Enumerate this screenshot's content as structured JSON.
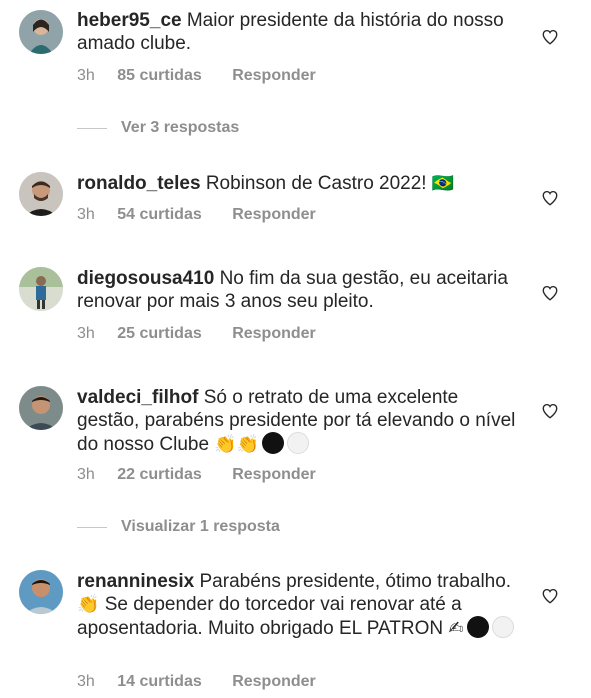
{
  "comments": [
    {
      "username": "heber95_ce",
      "text": "Maior presidente da história do nosso amado clube.",
      "time": "3h",
      "likes": "85 curtidas",
      "reply": "Responder",
      "view_replies": "Ver 3 respostas"
    },
    {
      "username": "ronaldo_teles",
      "text": "Robinson de Castro 2022!",
      "emoji": "🇧🇷",
      "time": "3h",
      "likes": "54 curtidas",
      "reply": "Responder"
    },
    {
      "username": "diegosousa410",
      "text": "No fim da sua gestão, eu aceitaria renovar por mais 3 anos seu pleito.",
      "time": "3h",
      "likes": "25 curtidas",
      "reply": "Responder"
    },
    {
      "username": "valdeci_filhof",
      "text": "Só o retrato de uma excelente gestão, parabéns presidente por tá elevando o nível do nosso Clube",
      "emoji": "👏👏",
      "time": "3h",
      "likes": "22 curtidas",
      "reply": "Responder",
      "view_replies": "Visualizar 1 resposta"
    },
    {
      "username": "renanninesix",
      "text_part1": "Parabéns presidente, ótimo trabalho.",
      "emoji1": "👏",
      "text_part2": "Se depender do torcedor vai renovar até a aposentadoria. Muito obrigado EL PATRON",
      "emoji2": "✍",
      "time": "3h",
      "likes": "14 curtidas",
      "reply": "Responder"
    }
  ],
  "icons": {
    "like": "heart-outline-icon"
  },
  "colors": {
    "text": "#262626",
    "meta": "#8e8e8e"
  }
}
